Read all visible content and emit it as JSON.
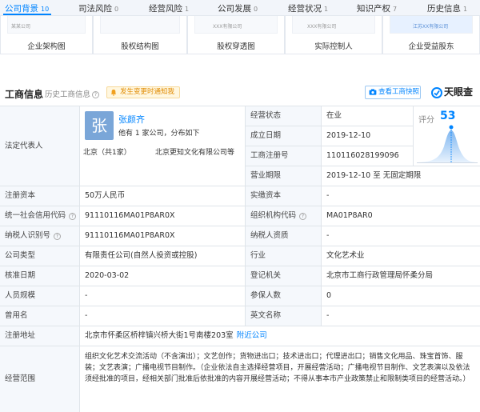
{
  "tabs": [
    {
      "label": "公司背景",
      "count": "10",
      "active": true
    },
    {
      "label": "司法风险",
      "count": "0",
      "active": false
    },
    {
      "label": "经营风险",
      "count": "1",
      "active": false
    },
    {
      "label": "公司发展",
      "count": "0",
      "active": false
    },
    {
      "label": "经营状况",
      "count": "1",
      "active": false
    },
    {
      "label": "知识产权",
      "count": "7",
      "active": false
    },
    {
      "label": "历史信息",
      "count": "1",
      "active": false
    }
  ],
  "thumbnails": [
    {
      "label": "企业架构图",
      "mini": "某某公司"
    },
    {
      "label": "股权结构图",
      "mini": ""
    },
    {
      "label": "股权穿透图",
      "mini": "XXX有限公司"
    },
    {
      "label": "实际控制人",
      "mini": "XXX有限公司"
    },
    {
      "label": "企业受益股东",
      "mini": "江苏XX有限公司"
    }
  ],
  "section": {
    "title": "工商信息",
    "history_link": "历史工商信息",
    "notice": "发生变更时通知我",
    "report_button": "查看工商快照",
    "brand": "天眼查"
  },
  "legal_rep": {
    "label": "法定代表人",
    "avatar_char": "张",
    "name": "张颜齐",
    "desc": "他有 1 家公司，分布如下",
    "city": "北京（共1家）",
    "company": "北京更知文化有限公司等"
  },
  "score": {
    "label": "评分",
    "value": "53"
  },
  "info": {
    "status_label": "经营状态",
    "status": "在业",
    "founded_label": "成立日期",
    "founded": "2019-12-10",
    "regno_label": "工商注册号",
    "regno": "110116028199096",
    "term_label": "营业期限",
    "term": "2019-12-10  至  无固定期限",
    "capital_label": "注册资本",
    "capital": "50万人民币",
    "paid_label": "实缴资本",
    "paid": "-",
    "credit_label": "统一社会信用代码",
    "credit": "91110116MA01P8AR0X",
    "org_label": "组织机构代码",
    "org": "MA01P8AR0",
    "tax_label": "纳税人识别号",
    "tax": "91110116MA01P8AR0X",
    "taxq_label": "纳税人资质",
    "taxq": "-",
    "type_label": "公司类型",
    "type": "有限责任公司(自然人投资或控股)",
    "industry_label": "行业",
    "industry": "文化艺术业",
    "approve_label": "核准日期",
    "approve": "2020-03-02",
    "authority_label": "登记机关",
    "authority": "北京市工商行政管理局怀柔分局",
    "staff_label": "人员规模",
    "staff": "-",
    "insured_label": "参保人数",
    "insured": "0",
    "former_label": "曾用名",
    "former": "-",
    "english_label": "英文名称",
    "english": "-",
    "address_label": "注册地址",
    "address": "北京市怀柔区桥梓镇兴桥大街1号南楼203室",
    "address_link": "附近公司",
    "scope_label": "经营范围",
    "scope": "组织文化艺术交流活动（不含演出）；文艺创作；货物进出口；技术进出口；代理进出口；销售文化用品、珠宝首饰、服装；文艺表演；广播电视节目制作。（企业依法自主选择经营项目，开展经营活动；广播电视节目制作、文艺表演以及依法须经批准的项目，经相关部门批准后依批准的内容开展经营活动；不得从事本市产业政策禁止和限制类项目的经营活动。）"
  }
}
